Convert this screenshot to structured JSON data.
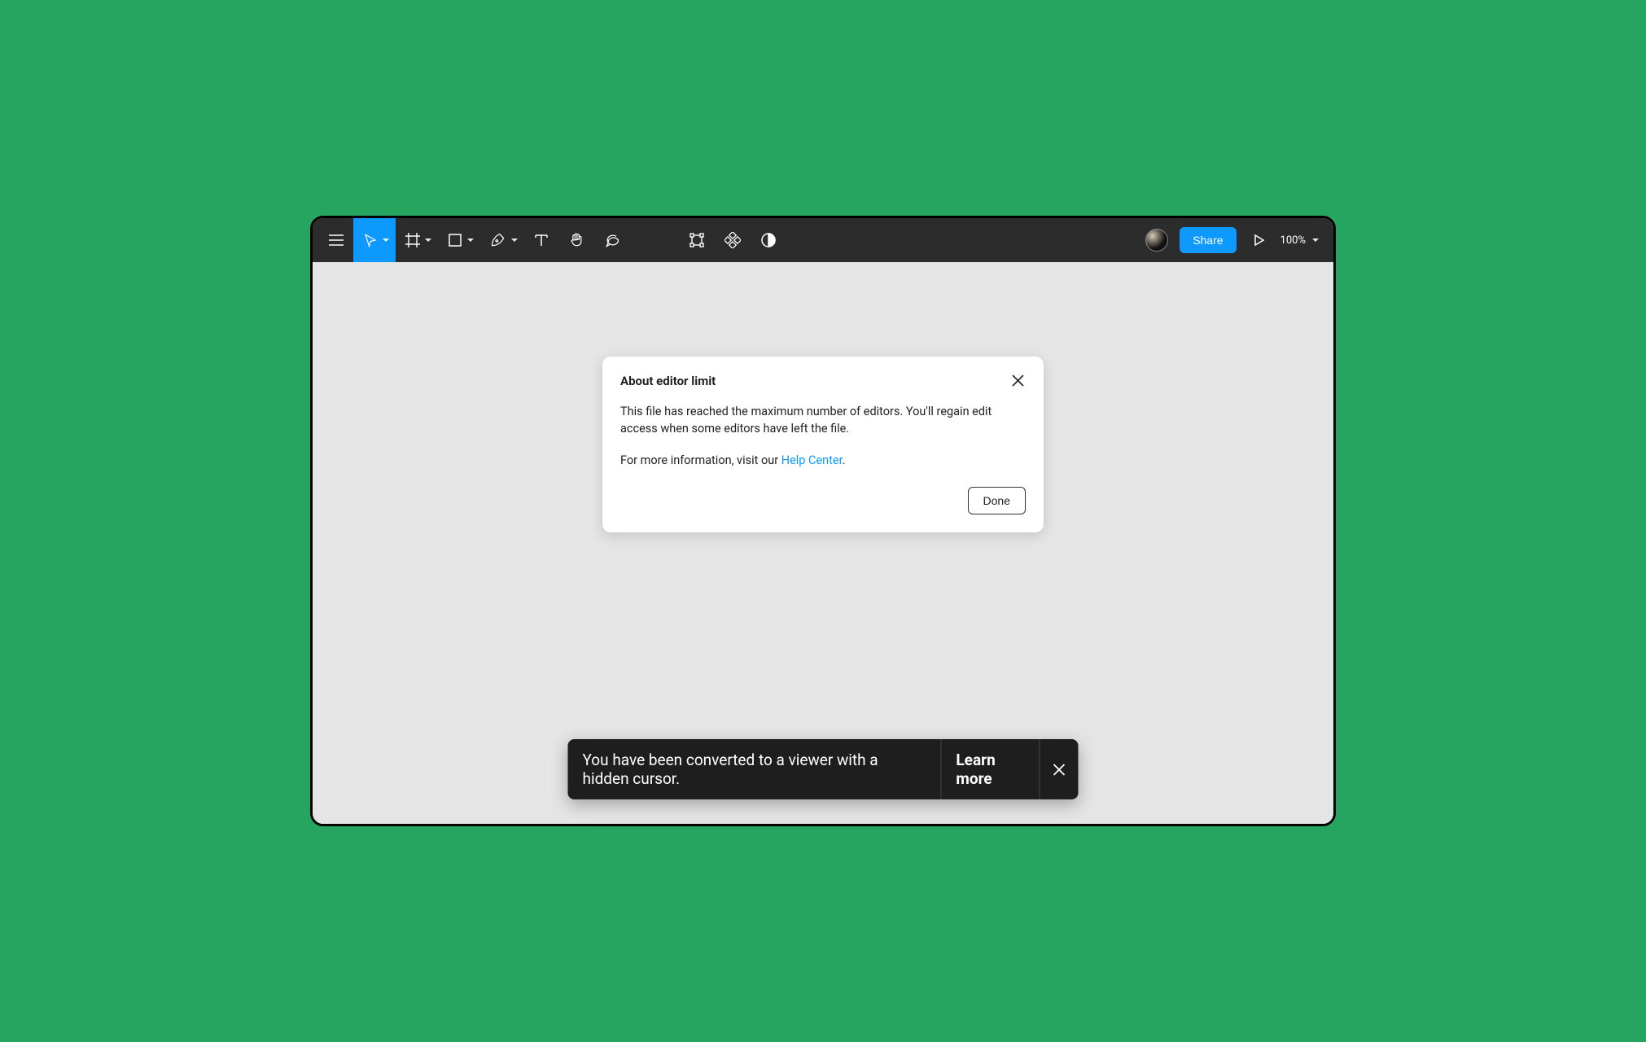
{
  "toolbar": {
    "share_label": "Share",
    "zoom_label": "100%"
  },
  "modal": {
    "title": "About editor limit",
    "body1": "This file has reached the maximum number of editors. You'll regain edit access when some editors have left the file.",
    "body2_prefix": "For more information, visit our ",
    "help_link": "Help Center",
    "body2_suffix": ".",
    "done_label": "Done"
  },
  "toast": {
    "message": "You have been converted to a viewer with a hidden cursor.",
    "action": "Learn more"
  },
  "colors": {
    "background": "#25a55f",
    "accent": "#0d99ff",
    "toolbar": "#2c2c2c",
    "canvas": "#e5e5e5"
  },
  "icons": {
    "menu": "menu-icon",
    "move": "cursor-icon",
    "frame": "frame-icon",
    "shape": "square-icon",
    "pen": "pen-icon",
    "text": "text-icon",
    "hand": "hand-icon",
    "comment": "comment-icon",
    "boundingbox": "bounding-box-icon",
    "components": "diamond-grid-icon",
    "mask": "half-circle-icon",
    "play": "play-icon"
  }
}
